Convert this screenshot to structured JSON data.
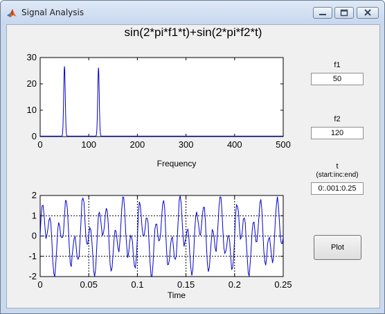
{
  "window": {
    "title": "Signal Analysis"
  },
  "figure": {
    "title": "sin(2*pi*f1*t)+sin(2*pi*f2*t)"
  },
  "controls": {
    "f1_label": "f1",
    "f1_value": "50",
    "f2_label": "f2",
    "f2_value": "120",
    "t_label": "t",
    "t_hint": "(start:inc:end)",
    "t_value": "0:.001:0.25",
    "plot_label": "Plot"
  },
  "colors": {
    "trace": "#0000cc",
    "axes_bg": "#ffffff"
  },
  "chart_data": [
    {
      "type": "line",
      "name": "frequency-spectrum",
      "xlabel": "Frequency",
      "ylabel": "",
      "xlim": [
        0,
        500
      ],
      "ylim": [
        0,
        30
      ],
      "xticks": [
        "0",
        "100",
        "200",
        "300",
        "400",
        "500"
      ],
      "yticks": [
        "0",
        "10",
        "20",
        "30"
      ],
      "grid": false,
      "peaks": [
        {
          "x": 50,
          "y": 26.5
        },
        {
          "x": 120,
          "y": 26
        }
      ]
    },
    {
      "type": "line",
      "name": "time-signal",
      "xlabel": "Time",
      "ylabel": "",
      "xlim": [
        0,
        0.25
      ],
      "ylim": [
        -2,
        2
      ],
      "xticks": [
        "0",
        "0.05",
        "0.1",
        "0.15",
        "0.2",
        "0.25"
      ],
      "yticks": [
        "-2",
        "-1",
        "0",
        "1",
        "2"
      ],
      "grid": true,
      "f1": 50,
      "f2": 120,
      "t_start": 0,
      "t_step": 0.001,
      "t_end": 0.25
    }
  ]
}
